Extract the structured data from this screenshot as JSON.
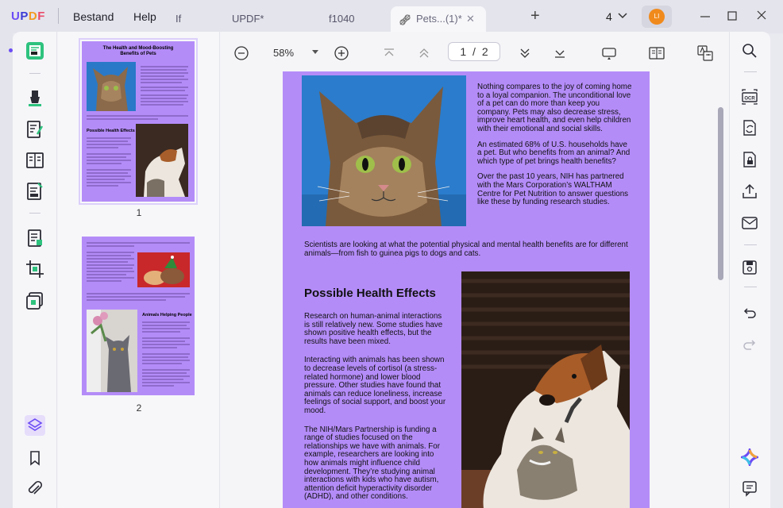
{
  "titlebar": {
    "logo": {
      "u": "U",
      "p": "P",
      "d": "D",
      "f": "F"
    },
    "menu": [
      "Bestand",
      "Help"
    ],
    "tabs": [
      {
        "label": "If"
      },
      {
        "label": "UPDF*"
      },
      {
        "label": "f1040"
      },
      {
        "label": "Pets...(1)*"
      }
    ],
    "tab_count": "4",
    "avatar_initials": "LI"
  },
  "toolbar": {
    "zoom": "58%",
    "page_current": "1",
    "page_sep": "/",
    "page_total": "2"
  },
  "thumbnails": [
    {
      "number": "1"
    },
    {
      "number": "2"
    }
  ],
  "document": {
    "intro_paragraphs": [
      "Nothing compares to the joy of coming home to a loyal companion. The unconditional love of a pet can do more than keep you company. Pets may also decrease stress, improve heart health, and even help children with their emotional and social skills.",
      "An estimated 68% of U.S. households have a pet. But who benefits from an animal? And which type of pet brings health benefits?",
      "Over the past 10 years, NIH has partnered with the Mars Corporation’s WALTHAM Centre for Pet Nutrition to answer questions like these by funding research studies."
    ],
    "scientists_paragraph": "Scientists are looking at what the potential physical and mental health benefits are for different animals—from fish to guinea pigs to dogs and cats.",
    "section_heading": "Possible Health Effects",
    "section_paragraphs": [
      "Research on human-animal interactions is still relatively new. Some studies have shown positive health effects, but the results have been mixed.",
      "Interacting with animals has been shown to decrease levels of cortisol (a stress-related hormone) and lower blood pressure. Other studies have found that animals can reduce loneliness, increase feelings of social support, and boost your mood.",
      "The NIH/Mars Partnership is funding a range of studies focused on the relationships we have with animals. For example, researchers are looking into how animals might influence child development. They’re studying animal interactions with kids who have autism, attention deficit hyperactivity disorder (ADHD), and other conditions."
    ]
  },
  "thumb_page1": {
    "title": "The Health and Mood-Boosting Benefits of Pets",
    "heading": "Possible Health Effects"
  },
  "thumb_page2": {
    "heading": "Animals Helping People"
  },
  "colors": {
    "page_bg": "#b48cf8",
    "accent": "#6c4cf5",
    "avatar": "#f08a1c"
  }
}
